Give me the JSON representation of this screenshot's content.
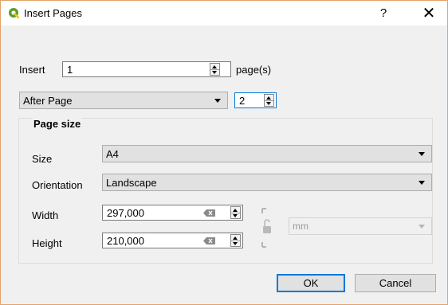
{
  "window": {
    "title": "Insert Pages",
    "help_glyph": "?",
    "close_glyph": "✕",
    "app_icon": "qgis-logo-icon"
  },
  "insert": {
    "label": "Insert",
    "count_value": "1",
    "suffix": "page(s)"
  },
  "position": {
    "mode": "After Page",
    "page_value": "2"
  },
  "page_size": {
    "group_title": "Page size",
    "size_label": "Size",
    "size_value": "A4",
    "orientation_label": "Orientation",
    "orientation_value": "Landscape",
    "width_label": "Width",
    "width_value": "297,000",
    "height_label": "Height",
    "height_value": "210,000",
    "units_value": "mm",
    "lock_icon": "unlocked-padlock-icon",
    "clear_icon": "clear-field-icon"
  },
  "buttons": {
    "ok": "OK",
    "cancel": "Cancel"
  },
  "colors": {
    "window_border": "#e3a36b",
    "default_button_border": "#0078d7",
    "qgis_green": "#5a9d2b"
  }
}
